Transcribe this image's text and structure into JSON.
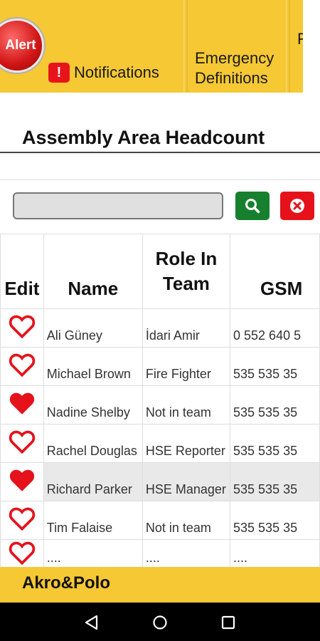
{
  "topbar": {
    "alert_label": "Alert",
    "notifications_badge": "!",
    "notifications_label": "Notifications",
    "emergency_line1": "Emergency",
    "emergency_line2": "Definitions",
    "next_tab_partial": "F"
  },
  "page": {
    "title": "Assembly Area Headcount"
  },
  "search": {
    "value": "",
    "placeholder": ""
  },
  "table": {
    "headers": {
      "edit": "Edit",
      "name": "Name",
      "role_line1": "Role In",
      "role_line2": "Team",
      "gsm": "GSM"
    },
    "rows": [
      {
        "favorite": false,
        "name": "Ali Güney",
        "role": "İdari Amir",
        "gsm": "0 552 640 5"
      },
      {
        "favorite": false,
        "name": "Michael Brown",
        "role": "Fire Fighter",
        "gsm": "535 535 35"
      },
      {
        "favorite": true,
        "name": "Nadine Shelby",
        "role": "Not in team",
        "gsm": "535 535 35"
      },
      {
        "favorite": false,
        "name": "Rachel Douglas",
        "role": "HSE Reporter",
        "gsm": "535 535 35"
      },
      {
        "favorite": true,
        "name": "Richard Parker",
        "role": "HSE Manager",
        "gsm": "535 535 35",
        "selected": true
      },
      {
        "favorite": false,
        "name": "Tim Falaise",
        "role": "Not in team",
        "gsm": "535 535 35"
      },
      {
        "favorite": false,
        "name": "....",
        "role": "....",
        "gsm": "...."
      }
    ]
  },
  "footer": {
    "label": "Akro&Polo"
  },
  "colors": {
    "accent_yellow": "#f6c834",
    "heart_red": "#e5121b",
    "search_green": "#17802f",
    "clear_red": "#e5121b"
  },
  "icons": {
    "search": "search-icon",
    "clear": "clear-icon",
    "heart": "heart-icon"
  }
}
